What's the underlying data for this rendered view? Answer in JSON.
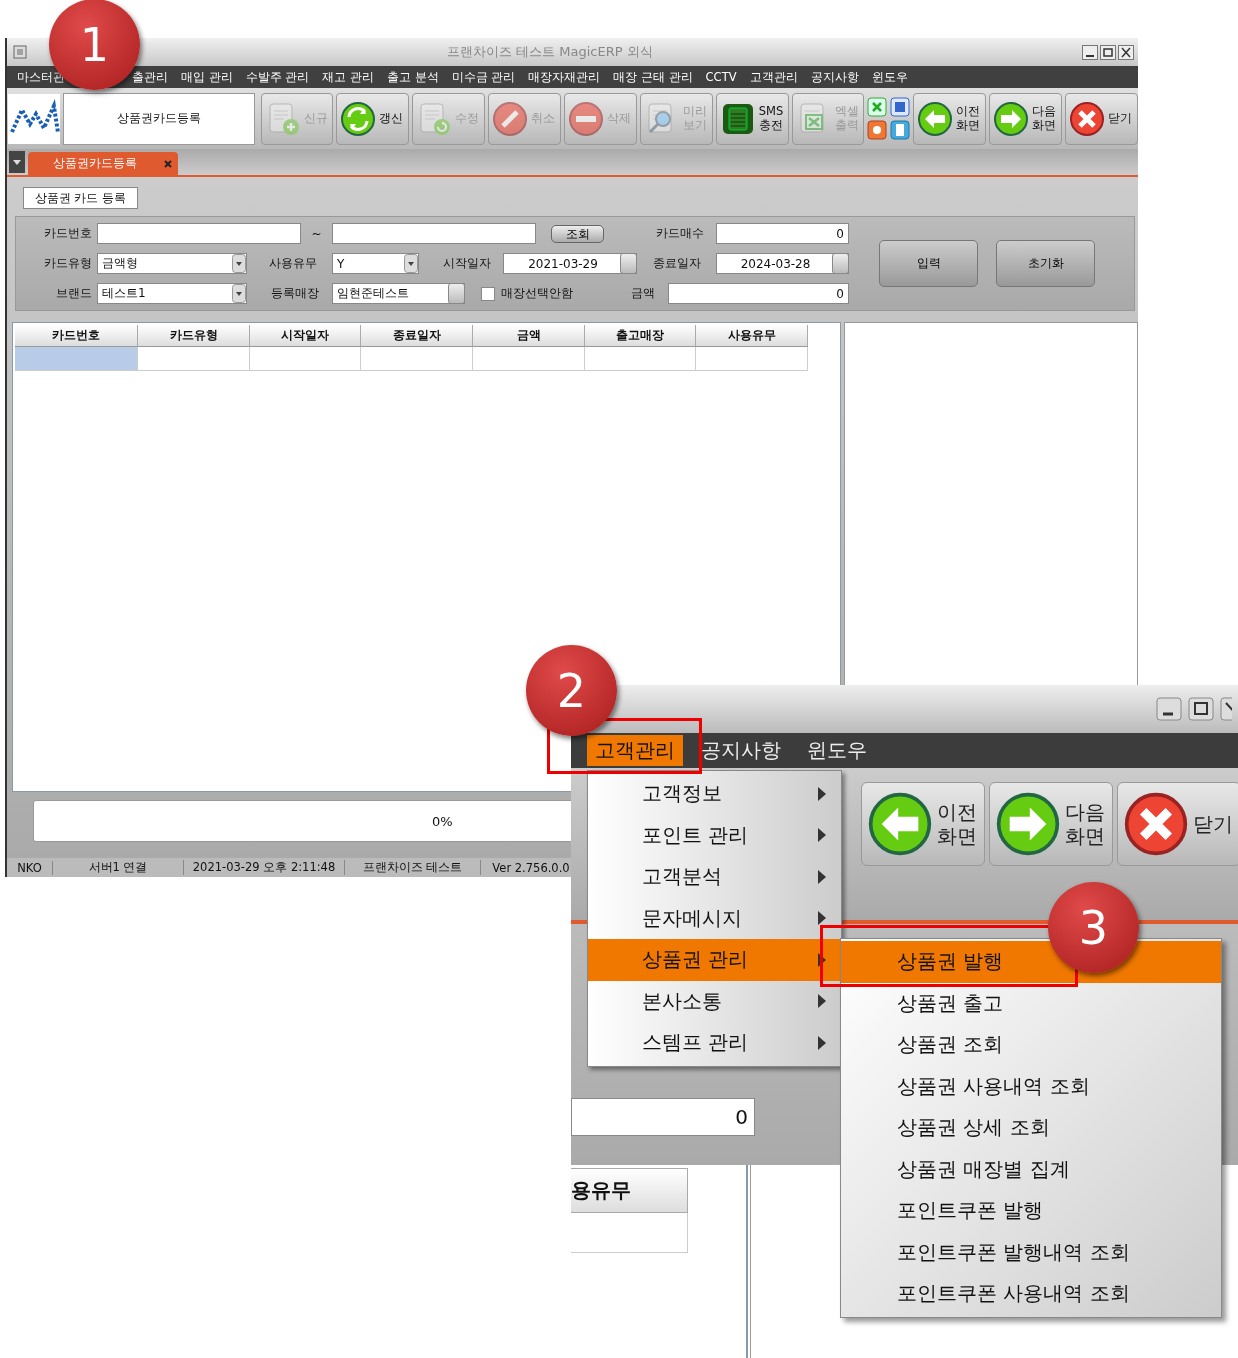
{
  "window": {
    "title": "프랜차이즈 테스트 MagicERP 외식"
  },
  "menu_bar": [
    {
      "label": "마스터관"
    },
    {
      "label": "출관리"
    },
    {
      "label": "매입 관리"
    },
    {
      "label": "수발주 관리"
    },
    {
      "label": "재고 관리"
    },
    {
      "label": "출고 분석"
    },
    {
      "label": "미수금 관리"
    },
    {
      "label": "매장자재관리"
    },
    {
      "label": "매장 근태 관리"
    },
    {
      "label": "CCTV"
    },
    {
      "label": "고객관리"
    },
    {
      "label": "공지사항"
    },
    {
      "label": "윈도우"
    }
  ],
  "toolbar": {
    "screen_name": "상품권카드등록",
    "buttons": [
      {
        "kind": "new",
        "lines": [
          "신규"
        ],
        "disabled": true
      },
      {
        "kind": "refresh",
        "lines": [
          "갱신"
        ],
        "disabled": false
      },
      {
        "kind": "edit",
        "lines": [
          "수정"
        ],
        "disabled": true
      },
      {
        "kind": "cancel",
        "lines": [
          "취소"
        ],
        "disabled": true
      },
      {
        "kind": "delete",
        "lines": [
          "삭제"
        ],
        "disabled": true
      },
      {
        "kind": "preview",
        "lines": [
          "미리",
          "보기"
        ],
        "disabled": true
      },
      {
        "kind": "sms",
        "lines": [
          "SMS",
          "충전"
        ],
        "disabled": false
      },
      {
        "kind": "excel",
        "lines": [
          "엑셀",
          "출력"
        ],
        "disabled": true
      },
      {
        "kind": "mini"
      },
      {
        "kind": "prev",
        "lines": [
          "이전",
          "화면"
        ],
        "disabled": false
      },
      {
        "kind": "next",
        "lines": [
          "다음",
          "화면"
        ],
        "disabled": false
      },
      {
        "kind": "close",
        "lines": [
          "닫기"
        ],
        "disabled": false
      }
    ]
  },
  "tabs": [
    {
      "label": "상품권카드등록",
      "selected": true
    }
  ],
  "section_title": "상품권 카드 등록",
  "form": {
    "items": [
      {
        "kind": "label",
        "text": "카드번호"
      },
      {
        "kind": "text"
      },
      {
        "kind": "label",
        "text": "~"
      },
      {
        "kind": "text"
      },
      {
        "kind": "button",
        "text": "조회"
      },
      {
        "kind": "label",
        "text": "카드매수"
      },
      {
        "kind": "number",
        "value": "0"
      },
      {
        "kind": "label",
        "text": "카드유형"
      },
      {
        "kind": "select",
        "value": "금액형"
      },
      {
        "kind": "label",
        "text": "사용유무"
      },
      {
        "kind": "select",
        "value": "Y"
      },
      {
        "kind": "label",
        "text": "시작일자"
      },
      {
        "kind": "date",
        "value": "2021-03-29"
      },
      {
        "kind": "label",
        "text": "종료일자"
      },
      {
        "kind": "date",
        "value": "2024-03-28"
      },
      {
        "kind": "label",
        "text": "브랜드"
      },
      {
        "kind": "select",
        "value": "테스트1"
      },
      {
        "kind": "label",
        "text": "등록매장"
      },
      {
        "kind": "picker",
        "value": "임현준테스트"
      },
      {
        "kind": "checkbox",
        "text": "매장선택안함",
        "checked": false
      },
      {
        "kind": "label",
        "text": "금액"
      },
      {
        "kind": "number",
        "value": "0"
      }
    ],
    "actions": [
      "입력",
      "초기화"
    ]
  },
  "grid": {
    "columns": [
      "카드번호",
      "카드유형",
      "시작일자",
      "종료일자",
      "금액",
      "출고매장",
      "사용유무"
    ],
    "rows": [
      {
        "selected": true
      }
    ]
  },
  "progress": {
    "level": 0,
    "reading": "0%"
  },
  "status_bar": [
    "NKO",
    "서버1 연결",
    "2021-03-29 오후 2:11:48",
    "프랜차이즈 테스트",
    "Ver 2.756.0.0"
  ],
  "zoom_inset": {
    "menu_bar": [
      {
        "label": "고객관리",
        "selected": true
      },
      {
        "label": "공지사항",
        "selected": false
      },
      {
        "label": "윈도우",
        "selected": false
      }
    ],
    "toolbar": [
      {
        "kind": "prev",
        "lines": [
          "이전",
          "화면"
        ]
      },
      {
        "kind": "next",
        "lines": [
          "다음",
          "화면"
        ]
      },
      {
        "kind": "close",
        "lines": [
          "닫기"
        ]
      }
    ],
    "field_value": "0",
    "column": "용유무",
    "menu": [
      {
        "label": "고객정보",
        "selected": false
      },
      {
        "label": "포인트 관리",
        "selected": false
      },
      {
        "label": "고객분석",
        "selected": false
      },
      {
        "label": "문자메시지",
        "selected": false
      },
      {
        "label": "상품권 관리",
        "selected": true
      },
      {
        "label": "본사소통",
        "selected": false
      },
      {
        "label": "스템프 관리",
        "selected": false
      }
    ],
    "submenu": [
      {
        "label": "상품권 발행",
        "selected": true
      },
      {
        "label": "상품권 출고",
        "selected": false
      },
      {
        "label": "상품권 조회",
        "selected": false
      },
      {
        "label": "상품권 사용내역 조회",
        "selected": false
      },
      {
        "label": "상품권 상세 조회",
        "selected": false
      },
      {
        "label": "상품권 매장별 집계",
        "selected": false
      },
      {
        "label": "포인트쿠폰 발행",
        "selected": false
      },
      {
        "label": "포인트쿠폰 발행내역 조회",
        "selected": false
      },
      {
        "label": "포인트쿠폰 사용내역 조회",
        "selected": false
      }
    ]
  },
  "callouts": [
    {
      "number": "1"
    },
    {
      "number": "2"
    },
    {
      "number": "3"
    }
  ]
}
